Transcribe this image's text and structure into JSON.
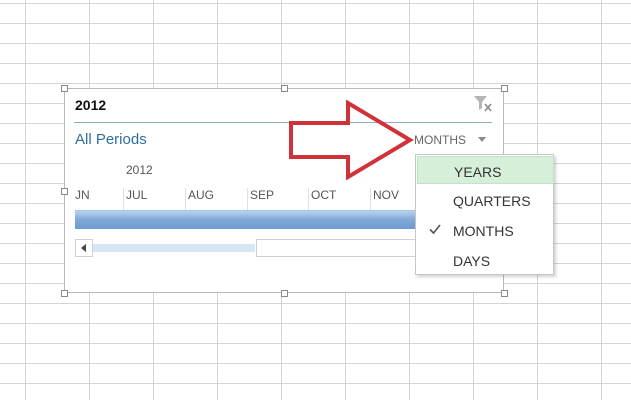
{
  "slicer": {
    "title": "2012",
    "all_periods": "All Periods",
    "year_label": "2012",
    "months": [
      "JN",
      "JUL",
      "AUG",
      "SEP",
      "OCT",
      "NOV"
    ],
    "time_level": "MONTHS",
    "icons": {
      "clear_filter": "clear-filter-icon",
      "level_dropdown": "chevron-down-icon",
      "scroll_left": "arrow-left-icon"
    }
  },
  "menu": {
    "items": [
      {
        "label": "YEARS",
        "highlighted": true,
        "checked": false
      },
      {
        "label": "QUARTERS",
        "highlighted": false,
        "checked": false
      },
      {
        "label": "MONTHS",
        "highlighted": false,
        "checked": true
      },
      {
        "label": "DAYS",
        "highlighted": false,
        "checked": false
      }
    ]
  },
  "colors": {
    "accent_blue": "#2e6e9e",
    "period_bar": "#7ea8d8",
    "menu_highlight": "#d5efd9",
    "annotation_arrow": "#d0323a"
  }
}
